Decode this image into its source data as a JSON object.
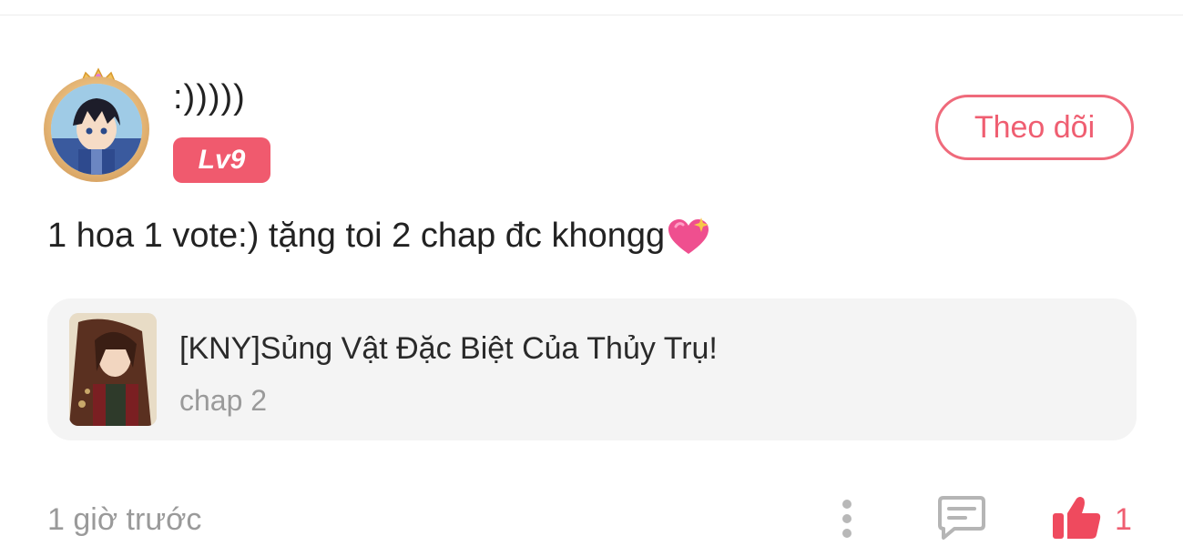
{
  "user": {
    "name": ":)))))",
    "level": "Lv9"
  },
  "follow": {
    "label": "Theo dõi"
  },
  "comment": {
    "text": "1 hoa 1 vote:) tặng toi 2 chap đc khongg",
    "emoji": "sparkling-heart-icon"
  },
  "story": {
    "title": "[KNY]Sủng Vật Đặc Biệt Của Thủy Trụ!",
    "chapter": "chap 2"
  },
  "footer": {
    "timestamp": "1 giờ trước",
    "like_count": "1"
  },
  "colors": {
    "accent": "#ef5e71",
    "badge": "#f05a6e",
    "card_bg": "#f4f4f4",
    "muted_text": "#9a9a9a"
  }
}
